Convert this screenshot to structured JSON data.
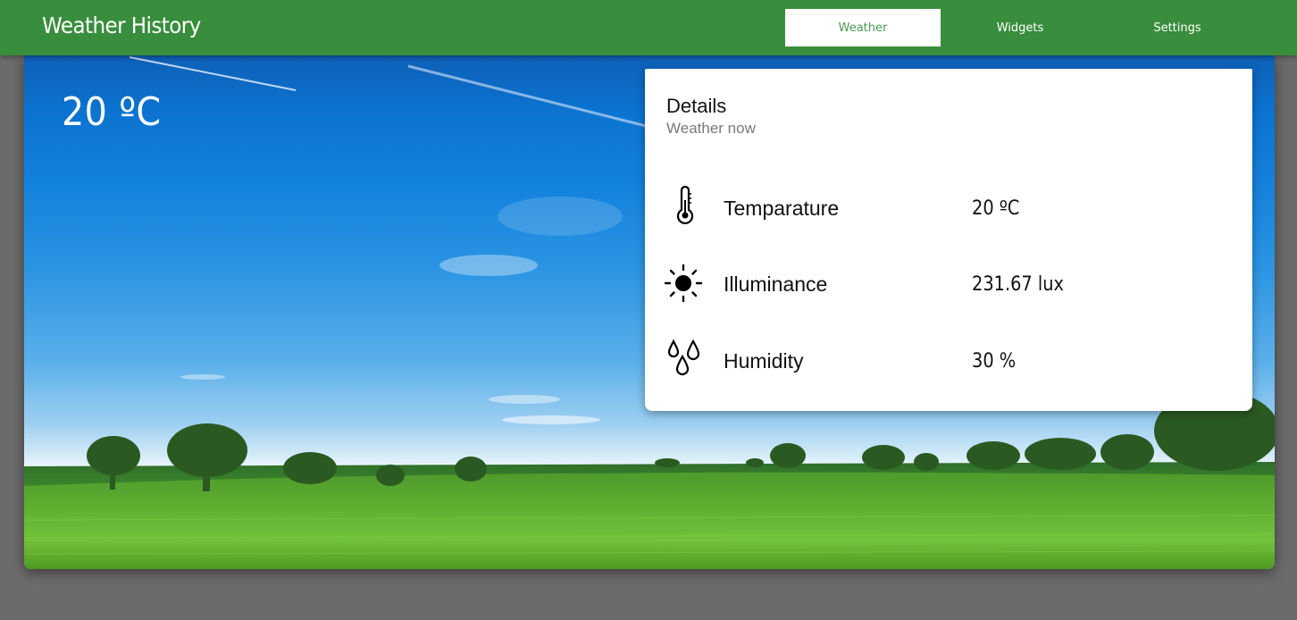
{
  "app": {
    "title": "Weather History"
  },
  "nav": {
    "tabs": [
      {
        "label": "Weather",
        "active": true
      },
      {
        "label": "Widgets",
        "active": false
      },
      {
        "label": "Settings",
        "active": false
      }
    ]
  },
  "hero": {
    "current_temperature": "20 ºC"
  },
  "details": {
    "title": "Details",
    "subtitle": "Weather now",
    "rows": [
      {
        "icon": "thermometer-icon",
        "label": "Temparature",
        "value": "20 ºC"
      },
      {
        "icon": "sun-icon",
        "label": "Illuminance",
        "value": "231.67 lux"
      },
      {
        "icon": "droplets-icon",
        "label": "Humidity",
        "value": "30 %"
      }
    ]
  },
  "colors": {
    "app_bar": "#388e3c",
    "active_tab_text": "#4d9a51",
    "page_background": "#6b6b6b",
    "card_background": "#ffffff"
  }
}
